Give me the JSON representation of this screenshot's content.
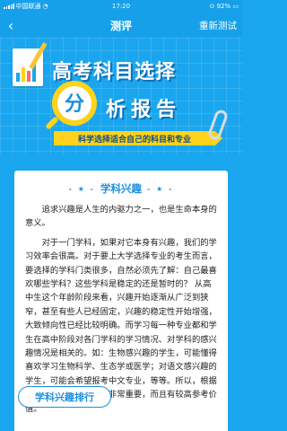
{
  "status": {
    "carrier": "中国联通",
    "time": "17:20",
    "battery": "92%"
  },
  "nav": {
    "title": "测评",
    "right_action": "重新测试"
  },
  "hero": {
    "title": "高考科目选择",
    "mag_char": "分",
    "subtitle": "析报告",
    "ribbon": "科学选择适合自己的科目和专业"
  },
  "section": {
    "title": "学科兴趣",
    "paragraphs": [
      "追求兴趣是人生的内驱力之一，也是生命本身的意义。",
      "对于一门学科，如果对它本身有兴趣，我们的学习效率会很高。对于要上大学选择专业的考生而言，要选择的学科门类很多，自然必须先了解：自己最喜欢哪些学科？这些学科是稳定的还是暂时的？ 从高中生这个年龄阶段来看，兴趣开始逐渐从广泛到狭窄，甚至有些人已经固定，兴趣的稳定性开始增强，大致倾向性已经比较明确。而学习每一种专业都和学生在高中阶段对各门学科的学习情况、对学科的感兴趣情况是相关的。如：生物感兴趣的学生，可能懂得喜欢学习生物科学、生态学或医学；对语文感兴趣的学生，可能会希望报考中文专业，等等。所以，根据学科兴趣来选择专业就非常重要，而且有较高参考价值。"
    ],
    "button_label": "学科兴趣排行"
  },
  "colors": {
    "primary": "#1aa6ee",
    "accent": "#ffd21c",
    "text_blue": "#1a8fe0"
  }
}
